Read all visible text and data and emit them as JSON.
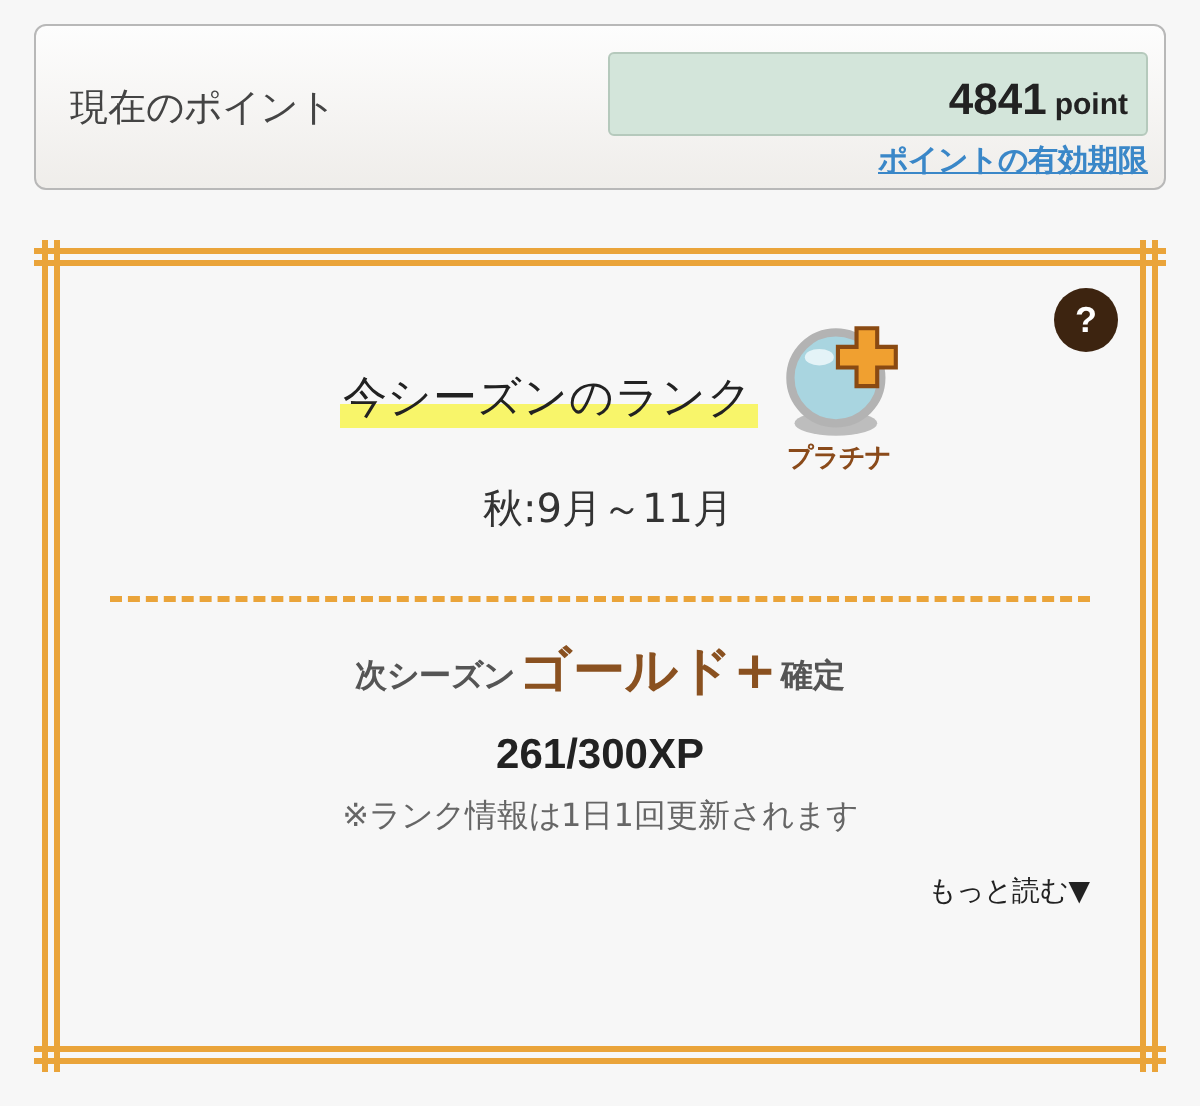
{
  "points": {
    "label": "現在のポイント",
    "value": "4841",
    "unit": "point",
    "link": "ポイントの有効期限"
  },
  "rank": {
    "help": "?",
    "title": "今シーズンのランク",
    "badge": {
      "label": "プラチナ"
    },
    "season": "秋:9月～11月",
    "next": {
      "prefix": "次シーズン",
      "rank": "ゴールド+",
      "suffix": "確定"
    },
    "xp": "261/300XP",
    "note": "※ランク情報は1日1回更新されます",
    "more": "もっと読む▼"
  }
}
